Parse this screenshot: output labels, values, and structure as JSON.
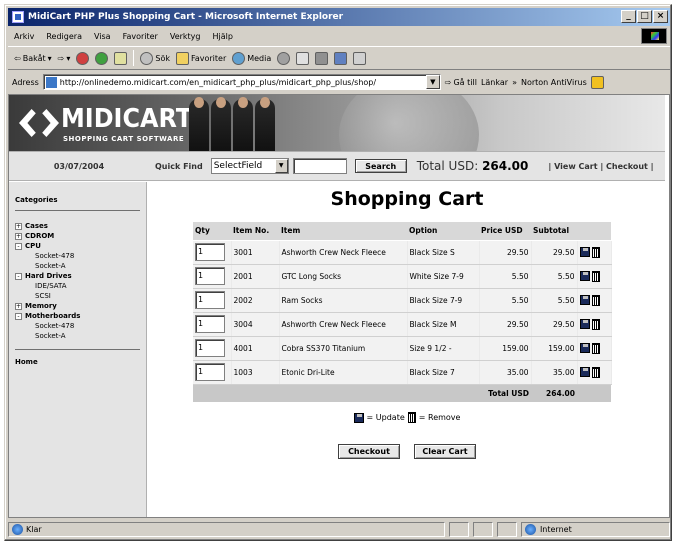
{
  "window": {
    "title": "MidiCart PHP Plus Shopping Cart - Microsoft Internet Explorer"
  },
  "menu": [
    "Arkiv",
    "Redigera",
    "Visa",
    "Favoriter",
    "Verktyg",
    "Hjälp"
  ],
  "toolbar": {
    "back": "Bakåt",
    "search": "Sök",
    "favorites": "Favoriter",
    "media": "Media"
  },
  "address": {
    "label": "Adress",
    "url": "http://onlinedemo.midicart.com/en_midicart_php_plus/midicart_php_plus/shop/",
    "go": "Gå till",
    "links": "Länkar",
    "norton": "Norton AntiVirus"
  },
  "banner": {
    "brand": "MIDICART",
    "tagline": "SHOPPING CART SOFTWARE"
  },
  "quickbar": {
    "date": "03/07/2004",
    "quick_find": "Quick Find",
    "select_field": "SelectField",
    "search_button": "Search",
    "total_label": "Total USD:",
    "total_value": "264.00",
    "links": "| View Cart | Checkout |"
  },
  "sidebar": {
    "categories_title": "Categories",
    "groups": [
      {
        "box": "+",
        "label": "Cases",
        "children": []
      },
      {
        "box": "+",
        "label": "CDROM",
        "children": []
      },
      {
        "box": "-",
        "label": "CPU",
        "children": [
          "Socket-478",
          "Socket-A"
        ]
      },
      {
        "box": "-",
        "label": "Hard Drives",
        "children": [
          "IDE/SATA",
          "SCSI"
        ]
      },
      {
        "box": "+",
        "label": "Memory",
        "children": []
      },
      {
        "box": "-",
        "label": "Motherboards",
        "children": [
          "Socket-478",
          "Socket-A"
        ]
      }
    ],
    "home": "Home"
  },
  "cart": {
    "heading": "Shopping Cart",
    "columns": [
      "Qty",
      "Item No.",
      "Item",
      "Option",
      "Price USD",
      "Subtotal"
    ],
    "rows": [
      {
        "qty": "1",
        "item_no": "3001",
        "item": "Ashworth Crew Neck Fleece",
        "option": "Black Size S",
        "price": "29.50",
        "subtotal": "29.50"
      },
      {
        "qty": "1",
        "item_no": "2001",
        "item": "GTC Long Socks",
        "option": "White Size 7-9",
        "price": "5.50",
        "subtotal": "5.50"
      },
      {
        "qty": "1",
        "item_no": "2002",
        "item": "Ram Socks",
        "option": "Black Size 7-9",
        "price": "5.50",
        "subtotal": "5.50"
      },
      {
        "qty": "1",
        "item_no": "3004",
        "item": "Ashworth Crew Neck Fleece",
        "option": "Black Size M",
        "price": "29.50",
        "subtotal": "29.50"
      },
      {
        "qty": "1",
        "item_no": "4001",
        "item": "Cobra SS370 Titanium",
        "option": "Size 9 1/2 -",
        "price": "159.00",
        "subtotal": "159.00"
      },
      {
        "qty": "1",
        "item_no": "1003",
        "item": "Etonic Dri-Lite",
        "option": "Black Size 7",
        "price": "35.00",
        "subtotal": "35.00"
      }
    ],
    "total_label": "Total USD",
    "total_value": "264.00",
    "legend_update": "= Update",
    "legend_remove": "= Remove",
    "checkout_button": "Checkout",
    "clear_button": "Clear Cart"
  },
  "status": {
    "left": "Klar",
    "zone": "Internet"
  }
}
